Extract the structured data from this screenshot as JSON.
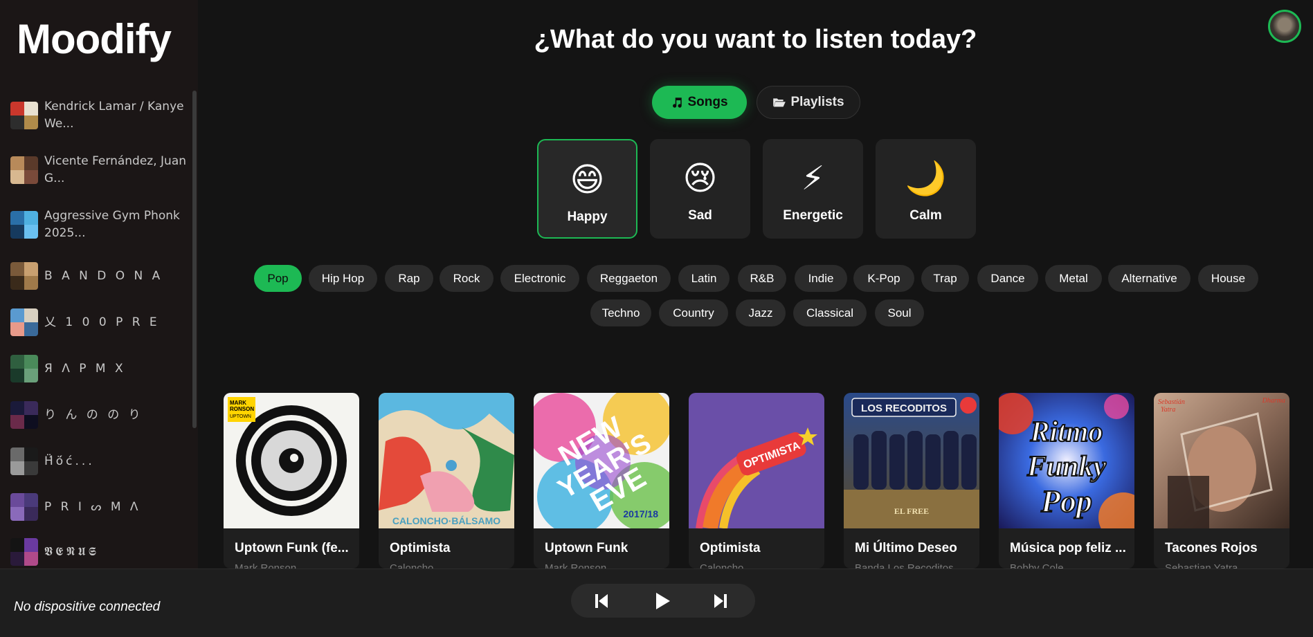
{
  "app": {
    "logo": "Moodify"
  },
  "header": {
    "title": "¿What do you want to listen today?",
    "avatar_icon": "user-avatar"
  },
  "toggle": {
    "songs_label": "Songs",
    "playlists_label": "Playlists",
    "songs_icon": "music-note-icon",
    "playlists_icon": "folder-open-icon"
  },
  "moods": [
    {
      "label": "Happy",
      "emoji": "😄",
      "active": true
    },
    {
      "label": "Sad",
      "emoji": "😢",
      "active": false
    },
    {
      "label": "Energetic",
      "emoji": "⚡",
      "active": false
    },
    {
      "label": "Calm",
      "emoji": "🌙",
      "active": false
    }
  ],
  "genres": [
    "Pop",
    "Hip Hop",
    "Rap",
    "Rock",
    "Electronic",
    "Reggaeton",
    "Latin",
    "R&B",
    "Indie",
    "K-Pop",
    "Trap",
    "Dance",
    "Metal",
    "Alternative",
    "House",
    "Techno",
    "Country",
    "Jazz",
    "Classical",
    "Soul"
  ],
  "active_genre": "Pop",
  "sidebar": {
    "playlists": [
      {
        "name": "Kendrick Lamar / Kanye We...",
        "colors": [
          "#c9372c",
          "#e8e0d0",
          "#2d2d2d",
          "#b08b4a"
        ]
      },
      {
        "name": "Vicente Fernández, Juan G...",
        "colors": [
          "#b88a5a",
          "#5a3a2a",
          "#d8b890",
          "#7a4a3a"
        ]
      },
      {
        "name": "Aggressive Gym Phonk 2025...",
        "colors": [
          "#2a6fa8",
          "#4fb0e0",
          "#163a5e",
          "#6ac0f0"
        ]
      },
      {
        "name": "B A N D O N A",
        "colors": [
          "#7a5a3a",
          "#c9a070",
          "#3a2a1a",
          "#a07a4a"
        ]
      },
      {
        "name": "乂 1 0 0 P R E",
        "colors": [
          "#5a9ad0",
          "#d8d0c0",
          "#e89a8a",
          "#3a6a9a"
        ]
      },
      {
        "name": "Я Λ Ρ Μ Χ",
        "colors": [
          "#2f5f3f",
          "#4a8a5a",
          "#1a3a2a",
          "#6aa07a"
        ]
      },
      {
        "name": "り ん の の り",
        "colors": [
          "#1a1a3a",
          "#3a2a5a",
          "#6a2a4a",
          "#0e0e20"
        ]
      },
      {
        "name": "Ḧ́ö́ć...",
        "colors": [
          "#6a6a6a",
          "#1a1a1a",
          "#9a9a9a",
          "#3a3a3a"
        ]
      },
      {
        "name": "P R I ᔕ M Λ",
        "colors": [
          "#6a4a9a",
          "#4a3a7a",
          "#8a6aba",
          "#3a2a5a"
        ]
      },
      {
        "name": "𝖁𝕰𝕹𝖀𝕾",
        "colors": [
          "#141414",
          "#6a3aa0",
          "#2a1a3a",
          "#b04a8a"
        ]
      }
    ]
  },
  "songs": [
    {
      "title": "Uptown Funk (fe...",
      "artist": "Mark Ronson",
      "cover_bg": "#f4f4f0",
      "cover_text": "MARK RONSON UPTOWN SPECIAL."
    },
    {
      "title": "Optimista",
      "artist": "Caloncho",
      "cover_bg": "#e9d8b8",
      "cover_text": "CALONCHO BÁLSAMO"
    },
    {
      "title": "Uptown Funk",
      "artist": "Mark Ronson",
      "cover_bg": "#f2f2f2",
      "cover_text": "NEW YEAR'S EVE 2017/18"
    },
    {
      "title": "Optimista",
      "artist": "Caloncho",
      "cover_bg": "#6a4fa8",
      "cover_text": "OPTIMISTA"
    },
    {
      "title": "Mi Último Deseo",
      "artist": "Banda Los Recoditos",
      "cover_bg": "#1c2a4a",
      "cover_text": "BANDA LOS RECODITOS"
    },
    {
      "title": "Música pop feliz ...",
      "artist": "Bobby Cole",
      "cover_bg": "#1a2a6a",
      "cover_text": "Ritmo Funky Pop"
    },
    {
      "title": "Tacones Rojos",
      "artist": "Sebastian Yatra",
      "cover_bg": "#8a7060",
      "cover_text": "Sebastián Yatra Dharma"
    }
  ],
  "player": {
    "device_status": "No dispositive connected",
    "prev_icon": "skip-back-icon",
    "play_icon": "play-icon",
    "next_icon": "skip-forward-icon"
  },
  "colors": {
    "accent": "#1db954",
    "background": "#141414",
    "sidebar": "#1b1616"
  }
}
